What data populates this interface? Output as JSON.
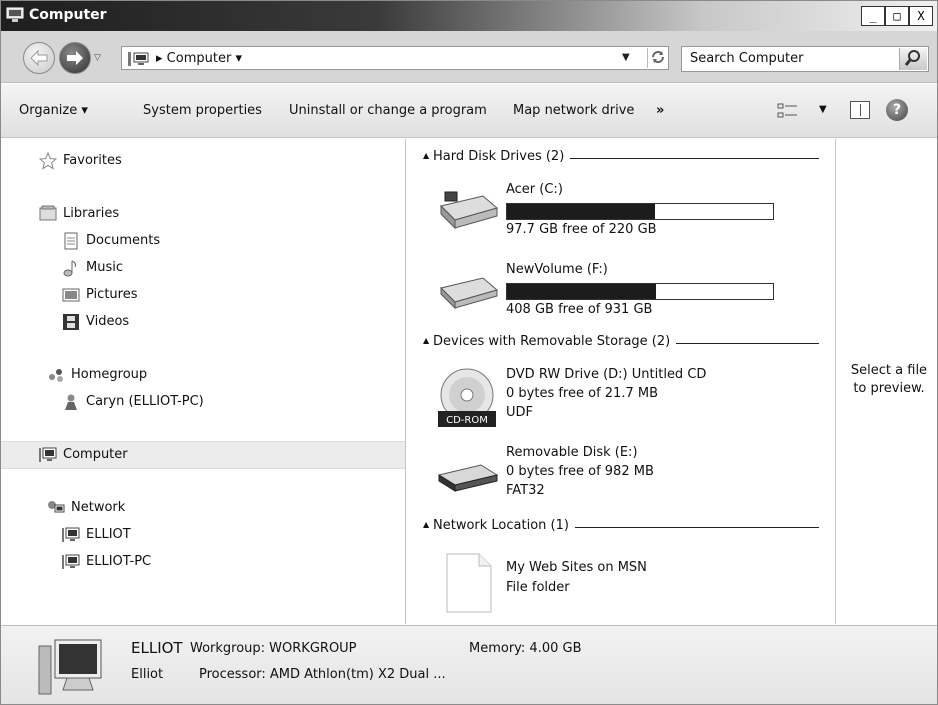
{
  "window": {
    "title": "Computer",
    "min": "_",
    "max": "□",
    "close": "X"
  },
  "address": {
    "path": "Computer",
    "search_placeholder": "Search Computer"
  },
  "toolbar": {
    "organize": "Organize ▾",
    "system_properties": "System properties",
    "uninstall": "Uninstall or change a program",
    "map_drive": "Map network drive",
    "more": "»",
    "help": "?"
  },
  "nav": {
    "favorites": "Favorites",
    "libraries": "Libraries",
    "documents": "Documents",
    "music": "Music",
    "pictures": "Pictures",
    "videos": "Videos",
    "homegroup": "Homegroup",
    "user": "Caryn (ELLIOT-PC)",
    "computer": "Computer",
    "network": "Network",
    "net1": "ELLIOT",
    "net2": "ELLIOT-PC"
  },
  "groups": {
    "hdd": "Hard Disk Drives (2)",
    "removable": "Devices with Removable Storage (2)",
    "netloc": "Network Location (1)"
  },
  "drives": {
    "c": {
      "name": "Acer (C:)",
      "free": "97.7 GB free of 220 GB",
      "used_fraction": 0.556
    },
    "f": {
      "name": "NewVolume (F:)",
      "free": "408 GB free of 931 GB",
      "used_fraction": 0.562
    },
    "d": {
      "name": "DVD RW Drive (D:) Untitled CD",
      "free": "0 bytes free of 21.7 MB",
      "fs": "UDF",
      "badge": "CD-ROM"
    },
    "e": {
      "name": "Removable Disk (E:)",
      "free": "0 bytes free of 982 MB",
      "fs": "FAT32"
    },
    "msn": {
      "name": "My Web Sites on MSN",
      "type": "File folder"
    }
  },
  "preview": {
    "line1": "Select a file",
    "line2": "to preview."
  },
  "details": {
    "name": "ELLIOT",
    "workgroup": "Workgroup: WORKGROUP",
    "memory": "Memory: 4.00 GB",
    "user": "Elliot",
    "processor": "Processor: AMD Athlon(tm) X2 Dual ..."
  }
}
